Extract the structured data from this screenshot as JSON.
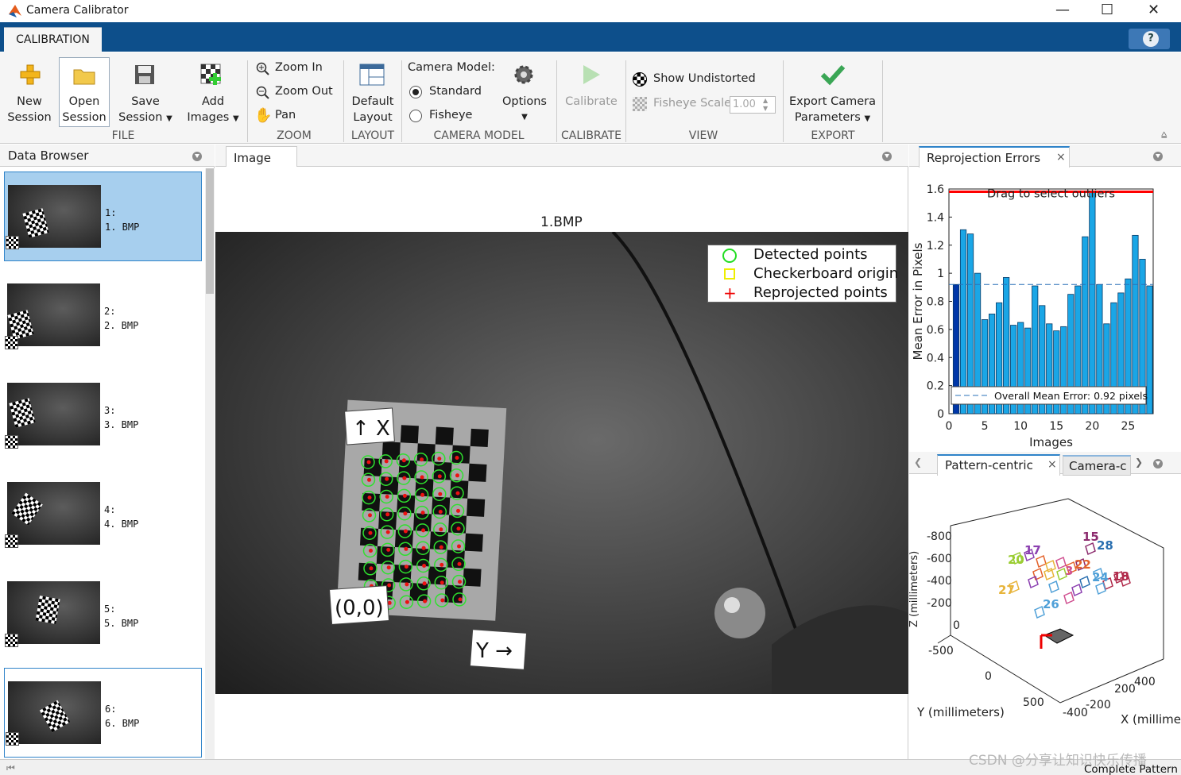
{
  "window": {
    "title": "Camera Calibrator"
  },
  "tabs": {
    "calibration": "CALIBRATION",
    "help": "?"
  },
  "toolstrip": {
    "new_session": [
      "New",
      "Session"
    ],
    "open_session": [
      "Open",
      "Session"
    ],
    "save_session": [
      "Save",
      "Session"
    ],
    "add_images": [
      "Add",
      "Images"
    ],
    "file_group": "FILE",
    "zoom_in": "Zoom In",
    "zoom_out": "Zoom Out",
    "pan": "Pan",
    "zoom_group": "ZOOM",
    "default_layout": [
      "Default",
      "Layout"
    ],
    "layout_group": "LAYOUT",
    "camera_model_label": "Camera Model:",
    "standard": "Standard",
    "fisheye": "Fisheye",
    "options": "Options",
    "camera_model_group": "CAMERA MODEL",
    "calibrate": "Calibrate",
    "calibrate_group": "CALIBRATE",
    "show_undistorted": "Show Undistorted",
    "fisheye_scale": "Fisheye Scale",
    "fisheye_scale_value": "1.00",
    "view_group": "VIEW",
    "export_camera": [
      "Export Camera",
      "Parameters"
    ],
    "export_group": "EXPORT"
  },
  "colors": {
    "accent": "#0d4f8b",
    "selection": "#a7cfee",
    "bar": "#1aa6e6",
    "highlight_bar": "#0036a8",
    "threshold": "#ff0000"
  },
  "data_browser": {
    "title": "Data Browser",
    "items": [
      {
        "index": "1:",
        "name": "1. BMP",
        "selected": true
      },
      {
        "index": "2:",
        "name": "2. BMP",
        "selected": false
      },
      {
        "index": "3:",
        "name": "3. BMP",
        "selected": false
      },
      {
        "index": "4:",
        "name": "4. BMP",
        "selected": false
      },
      {
        "index": "5:",
        "name": "5. BMP",
        "selected": false
      },
      {
        "index": "6:",
        "name": "6. BMP",
        "selected": false
      }
    ]
  },
  "image_panel": {
    "tab": "Image",
    "image_title": "1.BMP",
    "legend": [
      "Detected points",
      "Checkerboard origin",
      "Reprojected points"
    ],
    "label_x": "↑ X",
    "label_y": "Y →",
    "label_origin": "(0,0)"
  },
  "reprojection": {
    "tab": "Reprojection Errors",
    "annotation": "Drag to select outliers",
    "mean_label": "Overall Mean Error: 0.92 pixels"
  },
  "chart_data": {
    "type": "bar",
    "ylabel": "Mean Error in Pixels",
    "xlabel": "Images",
    "xticks": [
      0,
      5,
      10,
      15,
      20,
      25
    ],
    "yticks": [
      0,
      0.2,
      0.4,
      0.6,
      0.8,
      1,
      1.2,
      1.4,
      1.6
    ],
    "ytick_labels": [
      "0",
      "0.2",
      "0.4",
      "0.6",
      "0.8",
      "1",
      "1.2",
      "1.4",
      "1.6"
    ],
    "xlim": [
      0,
      28.5
    ],
    "ylim": [
      0,
      1.6
    ],
    "x": [
      1,
      2,
      3,
      4,
      5,
      6,
      7,
      8,
      9,
      10,
      11,
      12,
      13,
      14,
      15,
      16,
      17,
      18,
      19,
      20,
      21,
      22,
      23,
      24,
      25,
      26,
      27,
      28
    ],
    "values": [
      0.92,
      1.31,
      1.28,
      1.0,
      0.67,
      0.71,
      0.79,
      0.97,
      0.63,
      0.65,
      0.61,
      0.91,
      0.77,
      0.64,
      0.59,
      0.62,
      0.85,
      0.91,
      1.26,
      1.58,
      0.92,
      0.64,
      0.79,
      0.86,
      0.96,
      1.27,
      1.1,
      0.91
    ],
    "highlight_index": 0,
    "mean": 0.92,
    "threshold": 1.58
  },
  "extrinsics": {
    "tabs": [
      "Pattern-centric",
      "Camera-c"
    ],
    "zlabel": "Z (millimeters)",
    "ylabel": "Y (millimeters)",
    "xlabel": "X (millime",
    "zticks": [
      "-800",
      "-600",
      "-400",
      "-200",
      "0"
    ],
    "yticks": [
      "-500",
      "0",
      "500"
    ],
    "xticks": [
      "400",
      "200",
      "-200",
      "-400"
    ],
    "labels": [
      "15",
      "28",
      "17",
      "20",
      "22",
      "27",
      "18",
      "26",
      "24",
      "3"
    ]
  },
  "status": {
    "button": "Complete Pattern"
  },
  "watermark": "CSDN @分享让知识快乐传播"
}
